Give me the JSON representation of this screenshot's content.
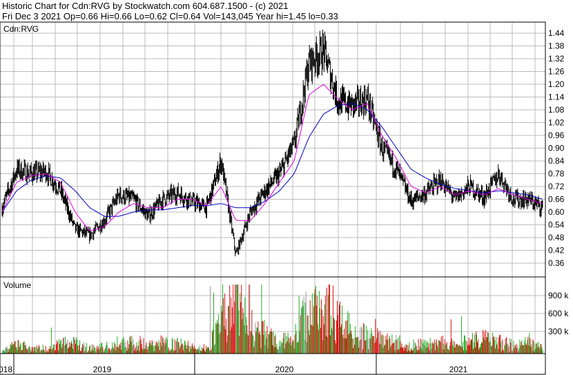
{
  "header": {
    "line1": "Historic Chart for Cdn:RVG by Stockwatch.com 604.687.1500 - (c) 2021",
    "line2": "Fri Dec  3 2021  Op=0.66  Hi=0.66  Lo=0.62  Cl=0.64  Vol=143,045  Year hi=1.45  lo=0.33"
  },
  "colors": {
    "price_bars": "#000000",
    "ma_short": "#e000e0",
    "ma_long": "#0000c0",
    "volume_up": "#22aa22",
    "volume_down": "#dd1111",
    "volume_flat": "#999999",
    "grid": "#bbbbbb"
  },
  "chart_data": [
    {
      "type": "line",
      "title": "Cdn:RVG",
      "ylim": [
        0.3,
        1.47
      ],
      "y_ticks": [
        "1.44",
        "1.38",
        "1.32",
        "1.26",
        "1.20",
        "1.14",
        "1.08",
        "1.02",
        "0.96",
        "0.90",
        "0.84",
        "0.78",
        "0.72",
        "0.66",
        "0.60",
        "0.54",
        "0.48",
        "0.42",
        "0.36"
      ],
      "x_ticks": [
        "018",
        "2019",
        "2020",
        "2021"
      ],
      "grid": true,
      "x": [
        "2018-11",
        "2018-12",
        "2019-01",
        "2019-02",
        "2019-03",
        "2019-04",
        "2019-05",
        "2019-06",
        "2019-07",
        "2019-08",
        "2019-09",
        "2019-10",
        "2019-11",
        "2019-12",
        "2020-01",
        "2020-02",
        "2020-03",
        "2020-04",
        "2020-05",
        "2020-06",
        "2020-07",
        "2020-08",
        "2020-09",
        "2020-10",
        "2020-11",
        "2020-12",
        "2021-01",
        "2021-02",
        "2021-03",
        "2021-04",
        "2021-05",
        "2021-06",
        "2021-07",
        "2021-08",
        "2021-09",
        "2021-10",
        "2021-11",
        "2021-12"
      ],
      "series": [
        {
          "values": [
            0.62,
            0.8,
            0.78,
            0.79,
            0.7,
            0.52,
            0.49,
            0.56,
            0.68,
            0.66,
            0.58,
            0.66,
            0.69,
            0.65,
            0.62,
            0.84,
            0.4,
            0.6,
            0.7,
            0.78,
            0.92,
            1.3,
            1.36,
            1.12,
            1.1,
            1.13,
            0.9,
            0.8,
            0.65,
            0.69,
            0.75,
            0.66,
            0.72,
            0.67,
            0.78,
            0.66,
            0.66,
            0.62
          ]
        },
        {
          "values": [
            0.6,
            0.74,
            0.77,
            0.78,
            0.74,
            0.6,
            0.51,
            0.53,
            0.6,
            0.64,
            0.62,
            0.62,
            0.66,
            0.66,
            0.63,
            0.72,
            0.56,
            0.56,
            0.64,
            0.74,
            0.84,
            1.15,
            1.2,
            1.13,
            1.08,
            1.11,
            0.96,
            0.85,
            0.72,
            0.69,
            0.72,
            0.68,
            0.7,
            0.68,
            0.71,
            0.68,
            0.66,
            0.64
          ]
        },
        {
          "values": [
            0.6,
            0.7,
            0.75,
            0.77,
            0.76,
            0.7,
            0.62,
            0.58,
            0.58,
            0.6,
            0.61,
            0.61,
            0.62,
            0.63,
            0.63,
            0.64,
            0.62,
            0.62,
            0.65,
            0.7,
            0.78,
            0.95,
            1.06,
            1.1,
            1.11,
            1.08,
            1.0,
            0.9,
            0.8,
            0.76,
            0.73,
            0.71,
            0.7,
            0.69,
            0.7,
            0.69,
            0.68,
            0.66
          ]
        }
      ]
    },
    {
      "type": "bar",
      "title": "Volume",
      "y_ticks": [
        "900 k",
        "600 k",
        "300 k"
      ],
      "ylim": [
        0,
        1100000
      ],
      "grid": true,
      "x": [
        "2018-11",
        "2018-12",
        "2019-01",
        "2019-02",
        "2019-03",
        "2019-04",
        "2019-05",
        "2019-06",
        "2019-07",
        "2019-08",
        "2019-09",
        "2019-10",
        "2019-11",
        "2019-12",
        "2020-01",
        "2020-02",
        "2020-03",
        "2020-04",
        "2020-05",
        "2020-06",
        "2020-07",
        "2020-08",
        "2020-09",
        "2020-10",
        "2020-11",
        "2020-12",
        "2021-01",
        "2021-02",
        "2021-03",
        "2021-04",
        "2021-05",
        "2021-06",
        "2021-07",
        "2021-08",
        "2021-09",
        "2021-10",
        "2021-11",
        "2021-12"
      ],
      "values": [
        60000,
        150000,
        120000,
        90000,
        200000,
        180000,
        100000,
        120000,
        160000,
        220000,
        150000,
        200000,
        180000,
        120000,
        100000,
        500000,
        1050000,
        400000,
        350000,
        200000,
        300000,
        800000,
        950000,
        650000,
        400000,
        300000,
        250000,
        200000,
        150000,
        180000,
        200000,
        150000,
        220000,
        250000,
        200000,
        150000,
        180000,
        143045
      ],
      "spikes": [
        1050000,
        950000,
        900000,
        800000,
        600000,
        450000
      ]
    }
  ]
}
